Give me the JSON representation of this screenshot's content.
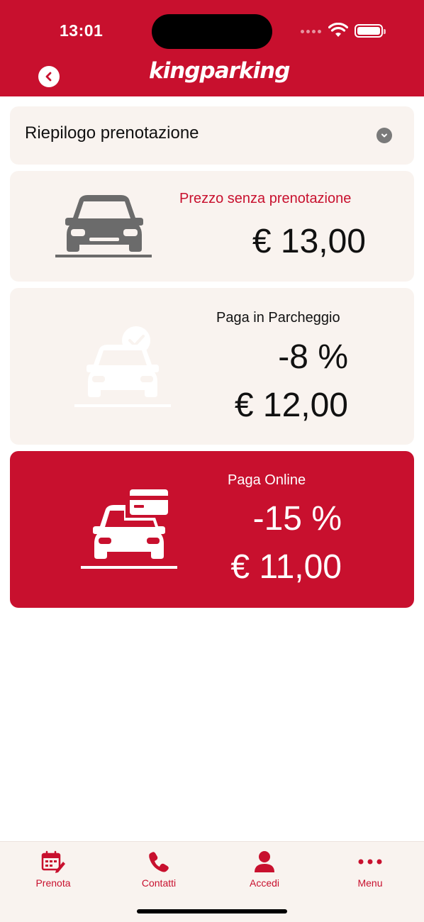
{
  "status_bar": {
    "time": "13:01"
  },
  "header": {
    "logo": "kingparking"
  },
  "summary": {
    "title": "Riepilogo prenotazione"
  },
  "price_no_booking": {
    "label": "Prezzo senza prenotazione",
    "price": "€ 13,00"
  },
  "pay_at_parking": {
    "label": "Paga in Parcheggio",
    "discount": "-8 %",
    "price": "€ 12,00"
  },
  "pay_online": {
    "label": "Paga Online",
    "discount": "-15 %",
    "price": "€ 11,00"
  },
  "nav": {
    "items": [
      {
        "label": "Prenota",
        "icon": "calendar-edit-icon"
      },
      {
        "label": "Contatti",
        "icon": "phone-icon"
      },
      {
        "label": "Accedi",
        "icon": "user-icon"
      },
      {
        "label": "Menu",
        "icon": "more-dots-icon"
      }
    ]
  },
  "colors": {
    "brand": "#c8102e",
    "card_bg": "#f9f3ef",
    "car_gray": "#6b6b6b"
  }
}
